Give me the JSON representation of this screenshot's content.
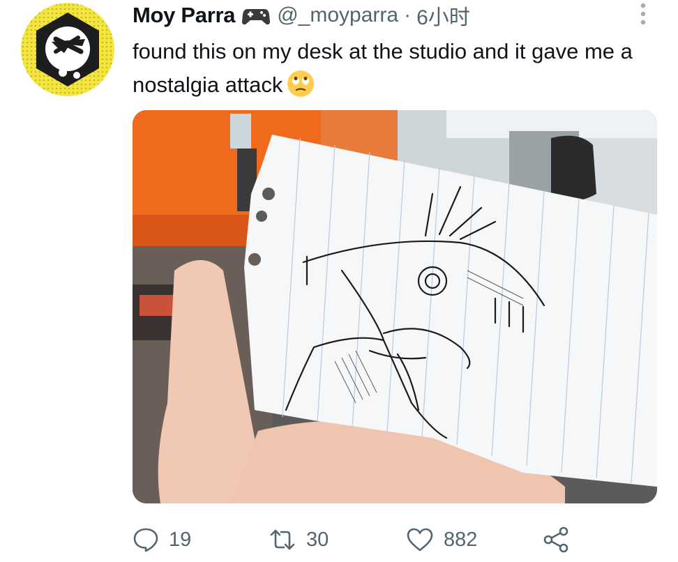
{
  "tweet": {
    "author_name": "Moy Parra",
    "author_emoji": "game-controller-emoji",
    "handle": "@_moyparra",
    "separator": "·",
    "time": "6小时",
    "text": "found this on my desk at the studio and it gave me a nostalgia attack",
    "text_emoji": "face-with-rolling-eyes-emoji"
  },
  "media": {
    "description_icons": [
      "desk-photo",
      "sketch-paper"
    ]
  },
  "actions": {
    "reply": {
      "icon": "reply-icon",
      "count": "19"
    },
    "retweet": {
      "icon": "retweet-icon",
      "count": "30"
    },
    "like": {
      "icon": "heart-icon",
      "count": "882"
    },
    "share": {
      "icon": "share-icon"
    }
  },
  "colors": {
    "text_primary": "#0f1419",
    "text_secondary": "#536471",
    "avatar_ring": "#f2e23a",
    "wall_orange": "#f06a1e"
  }
}
